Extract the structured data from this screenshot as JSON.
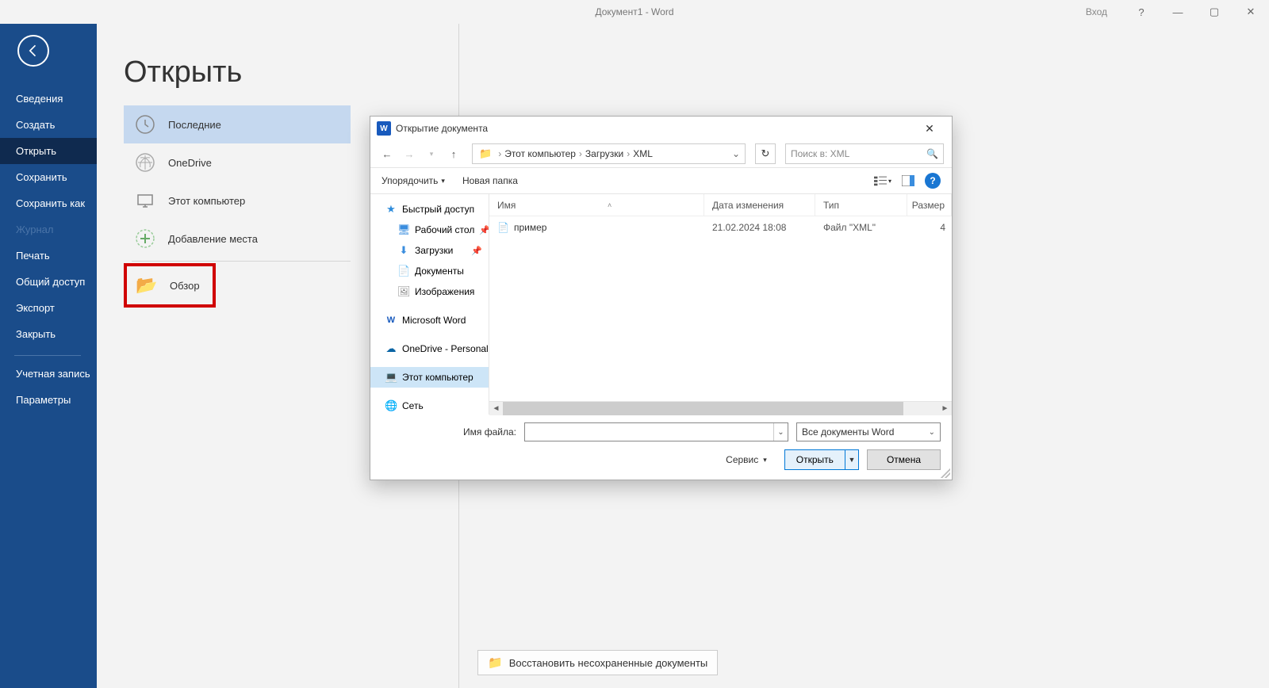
{
  "titlebar": {
    "doc": "Документ1  -  Word",
    "login": "Вход",
    "help": "?",
    "min": "—",
    "max": "▢",
    "close": "✕"
  },
  "sidebar": {
    "items": [
      {
        "label": "Сведения",
        "active": false
      },
      {
        "label": "Создать",
        "active": false
      },
      {
        "label": "Открыть",
        "active": true
      },
      {
        "label": "Сохранить",
        "active": false
      },
      {
        "label": "Сохранить как",
        "active": false
      },
      {
        "label": "Журнал",
        "active": false,
        "disabled": true
      },
      {
        "label": "Печать",
        "active": false
      },
      {
        "label": "Общий доступ",
        "active": false
      },
      {
        "label": "Экспорт",
        "active": false
      },
      {
        "label": "Закрыть",
        "active": false
      }
    ],
    "bottom": [
      {
        "label": "Учетная запись"
      },
      {
        "label": "Параметры"
      }
    ]
  },
  "page": {
    "title": "Открыть"
  },
  "locations": {
    "recent": "Последние",
    "onedrive": "OneDrive",
    "thispc": "Этот компьютер",
    "addplace": "Добавление места",
    "browse": "Обзор"
  },
  "recover": {
    "label": "Восстановить несохраненные документы"
  },
  "dialog": {
    "title": "Открытие документа",
    "breadcrumb": {
      "root": "Этот компьютер",
      "p1": "Загрузки",
      "p2": "XML"
    },
    "search_placeholder": "Поиск в: XML",
    "toolbar": {
      "organize": "Упорядочить",
      "newfolder": "Новая папка"
    },
    "tree": {
      "quick": "Быстрый доступ",
      "desktop": "Рабочий стол",
      "downloads": "Загрузки",
      "documents": "Документы",
      "pictures": "Изображения",
      "msword": "Microsoft Word",
      "onedrive": "OneDrive - Personal",
      "thispc": "Этот компьютер",
      "network": "Сеть"
    },
    "columns": {
      "name": "Имя",
      "date": "Дата изменения",
      "type": "Тип",
      "size": "Размер"
    },
    "files": [
      {
        "name": "пример",
        "date": "21.02.2024 18:08",
        "type": "Файл \"XML\"",
        "size": "4"
      }
    ],
    "bottom": {
      "filename_label": "Имя файла:",
      "filetype": "Все документы Word",
      "service": "Сервис",
      "open": "Открыть",
      "cancel": "Отмена"
    }
  }
}
